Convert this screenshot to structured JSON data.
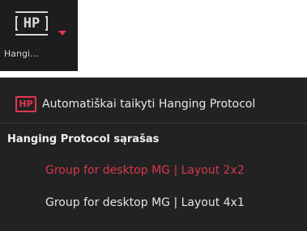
{
  "toolbar": {
    "icon_text": "HP",
    "icon": "hanging-protocol-icon",
    "label": "Hangi...",
    "caret_color": "#e5364f"
  },
  "menu": {
    "auto_apply": {
      "icon_text": "HP",
      "icon": "hanging-protocol-icon",
      "label": "Automatiškai taikyti Hanging Protocol"
    },
    "section_title": "Hanging Protocol sąrašas",
    "items": [
      {
        "label": "Group for desktop MG | Layout 2x2",
        "active": true
      },
      {
        "label": "Group for desktop MG | Layout 4x1",
        "active": false
      }
    ]
  },
  "colors": {
    "accent": "#e5364f",
    "background": "#222222",
    "text": "#e8e8e8"
  }
}
